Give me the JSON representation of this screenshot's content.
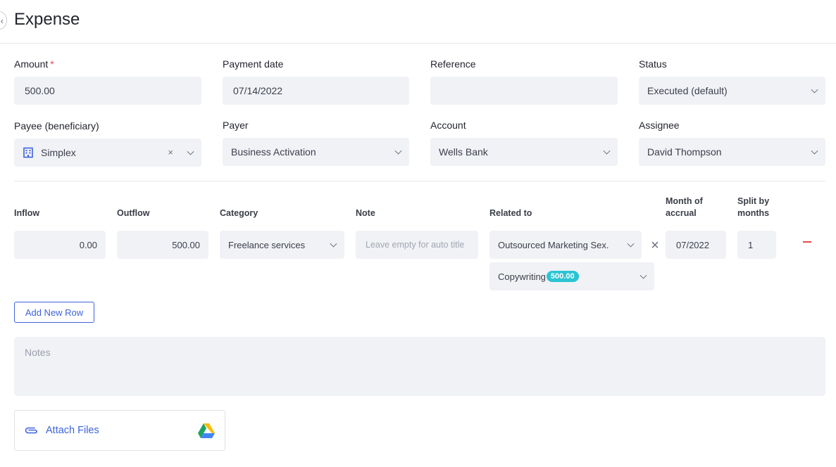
{
  "header": {
    "title": "Expense",
    "back_icon": "chevron-left-icon"
  },
  "form": {
    "amount": {
      "label": "Amount",
      "required_mark": "*",
      "value": "500.00"
    },
    "payment_date": {
      "label": "Payment date",
      "value": "07/14/2022"
    },
    "reference": {
      "label": "Reference",
      "value": ""
    },
    "status": {
      "label": "Status",
      "value": "Executed (default)"
    },
    "payee": {
      "label": "Payee (beneficiary)",
      "value": "Simplex",
      "clear": "×",
      "icon": "building-icon"
    },
    "payer": {
      "label": "Payer",
      "value": "Business Activation"
    },
    "account": {
      "label": "Account",
      "value": "Wells Bank"
    },
    "assignee": {
      "label": "Assignee",
      "value": "David Thompson"
    }
  },
  "table": {
    "headers": {
      "inflow": "Inflow",
      "outflow": "Outflow",
      "category": "Category",
      "note": "Note",
      "related_to": "Related to",
      "month_of_accrual": [
        "Month of",
        "accrual"
      ],
      "split_by_months": [
        "Split by",
        "months"
      ]
    },
    "row": {
      "inflow": "0.00",
      "outflow": "500.00",
      "category": "Freelance services",
      "note_placeholder": "Leave empty for auto title",
      "related_to": "Outsourced Marketing Sex.",
      "related_sub": "Copywriting",
      "related_sub_amount": "500.00",
      "month": "07/2022",
      "split": "1"
    }
  },
  "add_row_label": "Add New Row",
  "notes_placeholder": "Notes",
  "attach": {
    "label": "Attach Files",
    "icon": "paperclip-icon",
    "drive_icon": "google-drive-icon"
  },
  "colors": {
    "accent": "#3d63dd",
    "field_bg": "#f1f2f6",
    "badge": "#2bc4d3",
    "danger": "#e5484d"
  }
}
